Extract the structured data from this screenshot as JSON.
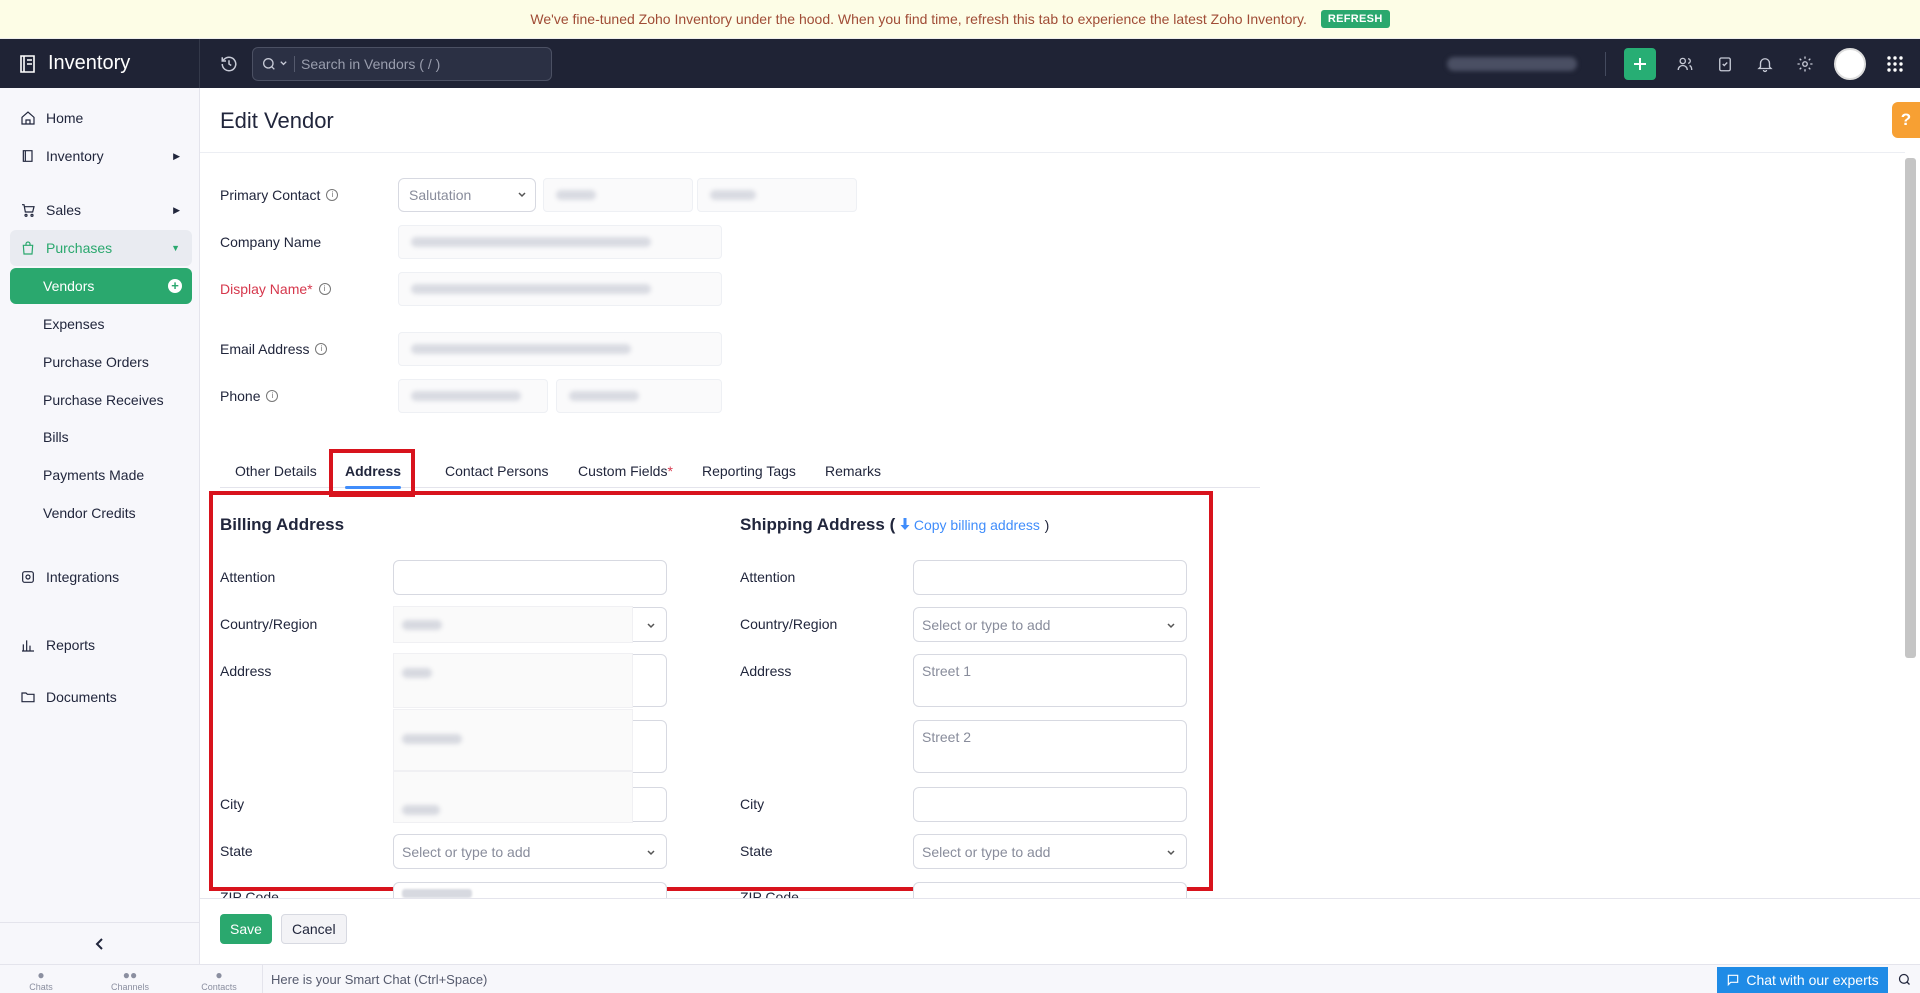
{
  "banner": {
    "message": "We've fine-tuned Zoho Inventory under the hood. When you find time, refresh this tab to experience the latest Zoho Inventory.",
    "refresh_label": "REFRESH"
  },
  "topbar": {
    "app_name": "Inventory",
    "search_placeholder": "Search in Vendors ( / )"
  },
  "sidebar": {
    "home": "Home",
    "inventory": "Inventory",
    "sales": "Sales",
    "purchases": "Purchases",
    "vendors": "Vendors",
    "expenses": "Expenses",
    "purchase_orders": "Purchase Orders",
    "purchase_receives": "Purchase Receives",
    "bills": "Bills",
    "payments_made": "Payments Made",
    "vendor_credits": "Vendor Credits",
    "integrations": "Integrations",
    "reports": "Reports",
    "documents": "Documents"
  },
  "page": {
    "title": "Edit Vendor"
  },
  "form": {
    "primary_contact": "Primary Contact",
    "salutation": "Salutation",
    "company_name": "Company Name",
    "display_name": "Display Name*",
    "email": "Email Address",
    "phone": "Phone"
  },
  "tabs": {
    "other_details": "Other Details",
    "address": "Address",
    "contact_persons": "Contact Persons",
    "custom_fields": "Custom Fields",
    "custom_fields_star": "*",
    "reporting_tags": "Reporting Tags",
    "remarks": "Remarks"
  },
  "billing": {
    "title": "Billing Address",
    "attention": "Attention",
    "country": "Country/Region",
    "address": "Address",
    "city": "City",
    "state": "State",
    "state_placeholder": "Select or type to add",
    "zip": "ZIP Code"
  },
  "shipping": {
    "title": "Shipping Address",
    "paren_open": "(",
    "copy_link": "Copy billing address",
    "paren_close": ")",
    "attention": "Attention",
    "country": "Country/Region",
    "country_placeholder": "Select or type to add",
    "address": "Address",
    "street1": "Street 1",
    "street2": "Street 2",
    "city": "City",
    "state": "State",
    "state_placeholder": "Select or type to add",
    "zip": "ZIP Code"
  },
  "footer": {
    "save": "Save",
    "cancel": "Cancel"
  },
  "bottombar": {
    "chats": "Chats",
    "channels": "Channels",
    "contacts": "Contacts",
    "smart_chat": "Here is your Smart Chat (Ctrl+Space)",
    "chat_experts": "Chat with our experts"
  },
  "colors": {
    "accent": "#2aa86e",
    "topbar": "#1f2335",
    "highlight": "#d8131d",
    "link": "#408dfb"
  }
}
